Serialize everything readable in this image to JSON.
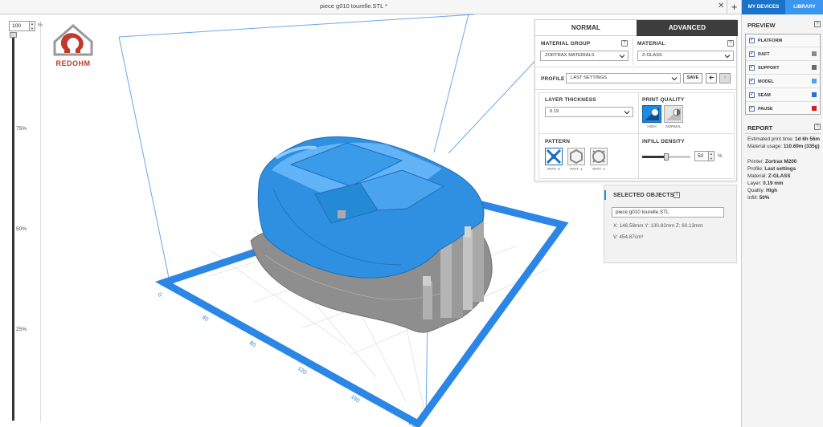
{
  "app": {
    "tab_title": "piece g010 tourelle.STL *",
    "close_glyph": "✕",
    "new_tab_glyph": "+"
  },
  "zoom": {
    "value": "100",
    "unit": "%",
    "ticks": [
      "75%",
      "50%",
      "25%"
    ]
  },
  "logo": {
    "text": "REDOHM",
    "color": "#c0392b"
  },
  "settings": {
    "mode_normal": "NORMAL",
    "mode_advanced": "ADVANCED",
    "material_group_label": "MATERIAL GROUP",
    "material_group_value": "ZORTRAX MATERIALS",
    "material_label": "MATERIAL",
    "material_value": "Z-GLASS",
    "profile_label": "PROFILE",
    "profile_value": "LAST SETTINGS",
    "save_label": "SAVE",
    "layer_thickness_label": "LAYER THICKNESS",
    "layer_thickness_value": "0.19",
    "print_quality_label": "PRINT QUALITY",
    "quality_high": "HIGH",
    "quality_normal": "NORMAL",
    "pattern_label": "PATTERN",
    "patterns": [
      "PATT. 0",
      "PATT. 1",
      "PATT. 2"
    ],
    "infill_label": "INFILL DENSITY",
    "infill_value": "50",
    "infill_unit": "%",
    "infill_fraction": 0.5,
    "help_glyph": "?"
  },
  "selected_objects": {
    "heading": "SELECTED OBJECTS",
    "name": "piece g010 tourelle.STL",
    "dimensions": "X: 146.58mm   Y: 130.82mm   Z: 60.13mm",
    "volume": "V: 454.87cm³"
  },
  "sidebar": {
    "tab_devices": "MY DEVICES",
    "tab_library": "LIBRARY",
    "preview_heading": "PREVIEW",
    "preview_items": [
      {
        "label": "PLATFORM",
        "swatch": ""
      },
      {
        "label": "RAFT",
        "swatch": "#8a8a8a"
      },
      {
        "label": "SUPPORT",
        "swatch": "#6a6a6a"
      },
      {
        "label": "MODEL",
        "swatch": "#4aa3ef"
      },
      {
        "label": "SEAM",
        "swatch": "#1e73d8"
      },
      {
        "label": "PAUSE",
        "swatch": "#d21f1f"
      }
    ],
    "report_heading": "REPORT",
    "print_time_label": "Estimated print time: ",
    "print_time_value": "1d 6h 56m",
    "material_usage_label": "Material usage: ",
    "material_usage_value": "110.69m (335g)",
    "printer_label": "Printer: ",
    "printer_value": "Zortrax M200",
    "profile_label": "Profile: ",
    "profile_value": "Last settings",
    "material_label": "Material: ",
    "material_value": "Z-GLASS",
    "layer_label": "Layer: ",
    "layer_value": "0.19 mm",
    "quality_label": "Quality: ",
    "quality_value": "High",
    "infill_label": "Infill: ",
    "infill_value": "50%"
  },
  "platform_axis": {
    "labels": [
      "0",
      "40",
      "80",
      "120",
      "160",
      "200"
    ]
  },
  "colors": {
    "accent": "#1e8be1",
    "model": "#2f8fe0",
    "platform": "#2b86e6",
    "build_volume": "#6aa8e8",
    "raft": "#8e8e8e"
  }
}
